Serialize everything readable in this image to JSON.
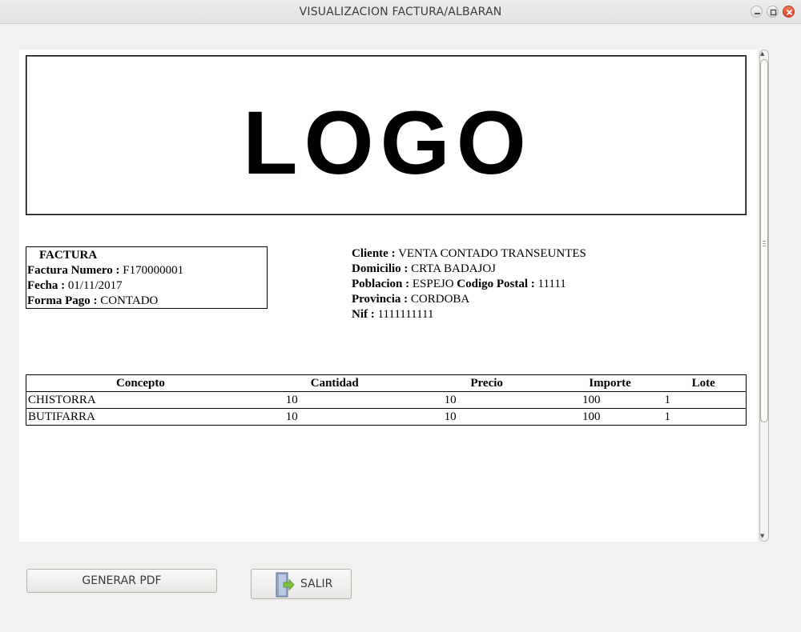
{
  "window": {
    "title": "VISUALIZACION FACTURA/ALBARAN"
  },
  "logo": {
    "text": "LOGO"
  },
  "factura": {
    "heading": "FACTURA",
    "numero_label": "Factura Numero :",
    "numero": "F170000001",
    "fecha_label": "Fecha :",
    "fecha": "01/11/2017",
    "forma_pago_label": "Forma Pago :",
    "forma_pago": "CONTADO"
  },
  "cliente": {
    "cliente_label": "Cliente :",
    "cliente": "VENTA CONTADO TRANSEUNTES",
    "domicilio_label": "Domicilio :",
    "domicilio": "CRTA BADAJOJ",
    "poblacion_label": "Poblacion :",
    "poblacion": "ESPEJO",
    "cp_label": "Codigo Postal :",
    "cp": "11111",
    "provincia_label": "Provincia :",
    "provincia": "CORDOBA",
    "nif_label": "Nif :",
    "nif": "1111111111"
  },
  "lines": {
    "headers": [
      "Concepto",
      "Cantidad",
      "Precio",
      "Importe",
      "Lote"
    ],
    "rows": [
      [
        "CHISTORRA",
        "10",
        "10",
        "100",
        "1"
      ],
      [
        "BUTIFARRA",
        "10",
        "10",
        "100",
        "1"
      ]
    ]
  },
  "buttons": {
    "pdf": "GENERAR PDF",
    "salir": "SALIR"
  },
  "icons": {
    "minimize": "minimize-icon",
    "maximize": "maximize-icon",
    "close": "close-icon",
    "exit": "exit-door-icon"
  },
  "colors": {
    "window_bg": "#f2f1f0",
    "close_button": "#e5573a",
    "exit_arrow": "#7ac143"
  }
}
